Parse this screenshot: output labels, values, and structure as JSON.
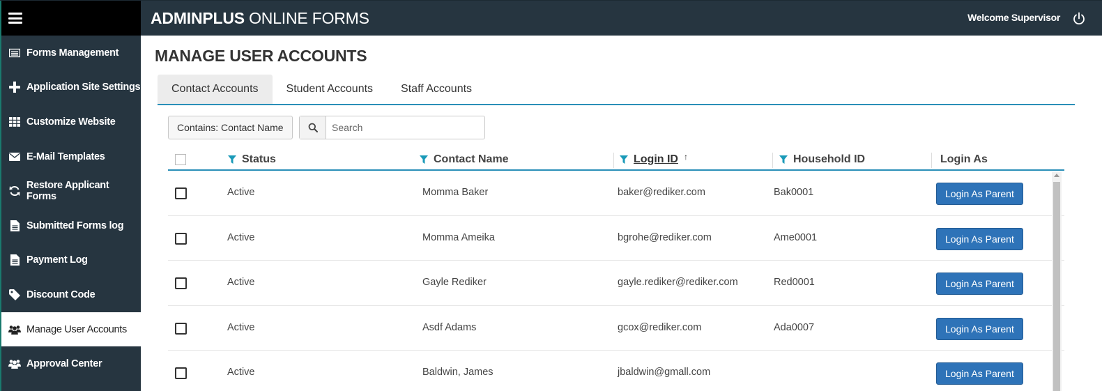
{
  "header": {
    "brand_bold": "ADMINPLUS",
    "brand_rest": " ONLINE FORMS",
    "welcome": "Welcome Supervisor"
  },
  "sidebar": {
    "items": [
      {
        "label": "Forms Management",
        "icon": "list-icon"
      },
      {
        "label": "Application Site Settings",
        "icon": "plus-icon"
      },
      {
        "label": "Customize Website",
        "icon": "grid-icon"
      },
      {
        "label": "E-Mail Templates",
        "icon": "envelope-icon"
      },
      {
        "label": "Restore Applicant Forms",
        "icon": "refresh-icon"
      },
      {
        "label": "Submitted Forms log",
        "icon": "document-icon"
      },
      {
        "label": "Payment Log",
        "icon": "document-icon"
      },
      {
        "label": "Discount Code",
        "icon": "tag-icon"
      },
      {
        "label": "Manage User Accounts",
        "icon": "users-icon",
        "active": true
      },
      {
        "label": "Approval Center",
        "icon": "users-icon"
      }
    ]
  },
  "main": {
    "title": "MANAGE USER ACCOUNTS",
    "tabs": [
      {
        "label": "Contact Accounts",
        "active": true
      },
      {
        "label": "Student Accounts"
      },
      {
        "label": "Staff Accounts"
      }
    ],
    "filter_label": "Contains: Contact Name",
    "search": {
      "placeholder": "Search",
      "value": ""
    }
  },
  "table": {
    "columns": {
      "status": "Status",
      "contact_name": "Contact Name",
      "login_id": "Login ID",
      "household_id": "Household ID",
      "login_as": "Login As"
    },
    "sort": {
      "column": "Login ID",
      "direction": "ascending"
    },
    "rows": [
      {
        "status": "Active",
        "name": "Momma Baker",
        "login": "baker@rediker.com",
        "household": "Bak0001",
        "action": "Login As Parent"
      },
      {
        "status": "Active",
        "name": "Momma Ameika",
        "login": "bgrohe@rediker.com",
        "household": "Ame0001",
        "action": "Login As Parent"
      },
      {
        "status": "Active",
        "name": "Gayle Rediker",
        "login": "gayle.rediker@rediker.com",
        "household": "Red0001",
        "action": "Login As Parent"
      },
      {
        "status": "Active",
        "name": "Asdf Adams",
        "login": "gcox@rediker.com",
        "household": "Ada0007",
        "action": "Login As Parent"
      },
      {
        "status": "Active",
        "name": "Baldwin, James",
        "login": "jbaldwin@gmall.com",
        "household": "",
        "action": "Login As Parent"
      }
    ]
  },
  "colors": {
    "sidebar_bg": "#263540",
    "header_bg": "#263540",
    "accent": "#2a8fb8",
    "button": "#2e73b8",
    "filter_icon": "#1a9ab8"
  }
}
